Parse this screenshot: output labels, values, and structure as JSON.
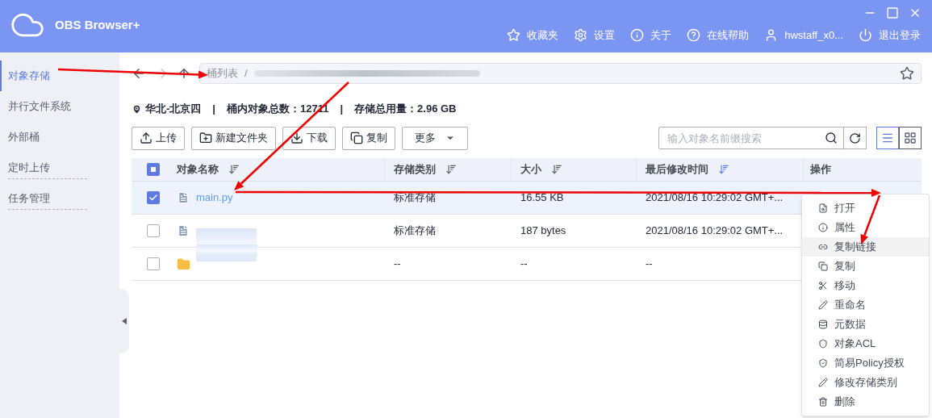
{
  "app": {
    "title": "OBS Browser+"
  },
  "header_actions": [
    {
      "kind": "favorites",
      "label": "收藏夹"
    },
    {
      "kind": "settings",
      "label": "设置"
    },
    {
      "kind": "about",
      "label": "关于"
    },
    {
      "kind": "help",
      "label": "在线帮助"
    },
    {
      "kind": "user",
      "label": "hwstaff_x0..."
    },
    {
      "kind": "logout",
      "label": "退出登录"
    }
  ],
  "sidebar": {
    "items": [
      {
        "label": "对象存储",
        "selected": true,
        "divider": false
      },
      {
        "label": "并行文件系统",
        "selected": false,
        "divider": false
      },
      {
        "label": "外部桶",
        "selected": false,
        "divider": false
      },
      {
        "label": "定时上传",
        "selected": false,
        "divider": true
      },
      {
        "label": "任务管理",
        "selected": false,
        "divider": true
      }
    ]
  },
  "path": {
    "root": "桶列表",
    "separator": "/"
  },
  "info": {
    "region": "华北-北京四",
    "separator": "|",
    "count_label": "桶内对象总数：",
    "count": "12711",
    "usage_label": "存储总用量：",
    "usage": "2.96 GB"
  },
  "toolbar": {
    "buttons": [
      {
        "kind": "upload",
        "label": "上传"
      },
      {
        "kind": "new-folder",
        "label": "新建文件夹"
      },
      {
        "kind": "download",
        "label": "下载"
      },
      {
        "kind": "copy",
        "label": "复制"
      },
      {
        "kind": "more",
        "label": "更多"
      }
    ],
    "search": {
      "placeholder": "输入对象名前缀搜索"
    },
    "views": [
      {
        "kind": "list",
        "selected": true
      },
      {
        "kind": "grid",
        "selected": false
      }
    ]
  },
  "table": {
    "select_all": {
      "indeterminate": true
    },
    "columns": [
      {
        "label": "对象名称",
        "sort_active": false
      },
      {
        "label": "存储类别",
        "sort_active": false
      },
      {
        "label": "大小",
        "sort_active": false
      },
      {
        "label": "最后修改时间",
        "sort_active": true
      },
      {
        "label": "操作"
      }
    ],
    "rows": [
      {
        "kind": "file",
        "checked": true,
        "name": "main.py",
        "storage": "标准存储",
        "size": "16.55 KB",
        "modified": "2021/08/16 10:29:02 GMT+..."
      },
      {
        "kind": "file",
        "checked": false,
        "storage": "标准存储",
        "size": "187 bytes",
        "modified": "2021/08/16 10:29:02 GMT+..."
      },
      {
        "kind": "folder",
        "checked": false,
        "storage": "--",
        "size": "--",
        "modified": "--"
      }
    ]
  },
  "context_menu": {
    "items": [
      {
        "kind": "open",
        "label": "打开",
        "hovered": false
      },
      {
        "kind": "info",
        "label": "属性",
        "hovered": false
      },
      {
        "kind": "link",
        "label": "复制链接",
        "hovered": true
      },
      {
        "kind": "copy",
        "label": "复制",
        "hovered": false
      },
      {
        "kind": "move",
        "label": "移动",
        "hovered": false
      },
      {
        "kind": "rename",
        "label": "重命名",
        "hovered": false
      },
      {
        "kind": "metadata",
        "label": "元数据",
        "hovered": false
      },
      {
        "kind": "acl",
        "label": "对象ACL",
        "hovered": false
      },
      {
        "kind": "policy",
        "label": "简易Policy授权",
        "hovered": false
      },
      {
        "kind": "edit",
        "label": "修改存储类别",
        "hovered": false
      },
      {
        "kind": "delete",
        "label": "删除",
        "hovered": false
      }
    ]
  }
}
